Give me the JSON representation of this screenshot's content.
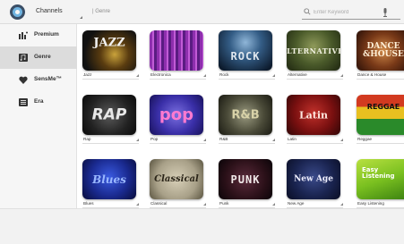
{
  "header": {
    "title": "Channels",
    "breadcrumb": "| Genre",
    "search_placeholder": "Enter Keyword"
  },
  "sidebar": {
    "items": [
      {
        "label": "Premium",
        "icon": "premium-icon",
        "active": false
      },
      {
        "label": "Genre",
        "icon": "music-note-icon",
        "active": true
      },
      {
        "label": "SensMe™",
        "icon": "heart-icon",
        "active": false
      },
      {
        "label": "Era",
        "icon": "era-icon",
        "active": false
      }
    ]
  },
  "genres": [
    {
      "label": "Jazz",
      "art_text": "JAZZ"
    },
    {
      "label": "Electronica",
      "art_text": ""
    },
    {
      "label": "Rock",
      "art_text": "ROCK"
    },
    {
      "label": "Alternative",
      "art_text": "LTERNATIVE"
    },
    {
      "label": "Dance & House",
      "art_text": "DANCE &HOUSE"
    },
    {
      "label": "Rap",
      "art_text": "RAP"
    },
    {
      "label": "Pop",
      "art_text": "pop"
    },
    {
      "label": "R&B",
      "art_text": "R&B"
    },
    {
      "label": "Latin",
      "art_text": "Latin"
    },
    {
      "label": "Reggae",
      "art_text": "REGGAE"
    },
    {
      "label": "Blues",
      "art_text": "Blues"
    },
    {
      "label": "Classical",
      "art_text": "Classical"
    },
    {
      "label": "Punk",
      "art_text": "PUNK"
    },
    {
      "label": "New Age",
      "art_text": "New Age"
    },
    {
      "label": "Easy Listening",
      "art_text": "Easy Listening"
    }
  ],
  "colors": {
    "active_sidebar": "#dcdcdc",
    "topbar_bg": "#f3f3f3"
  }
}
